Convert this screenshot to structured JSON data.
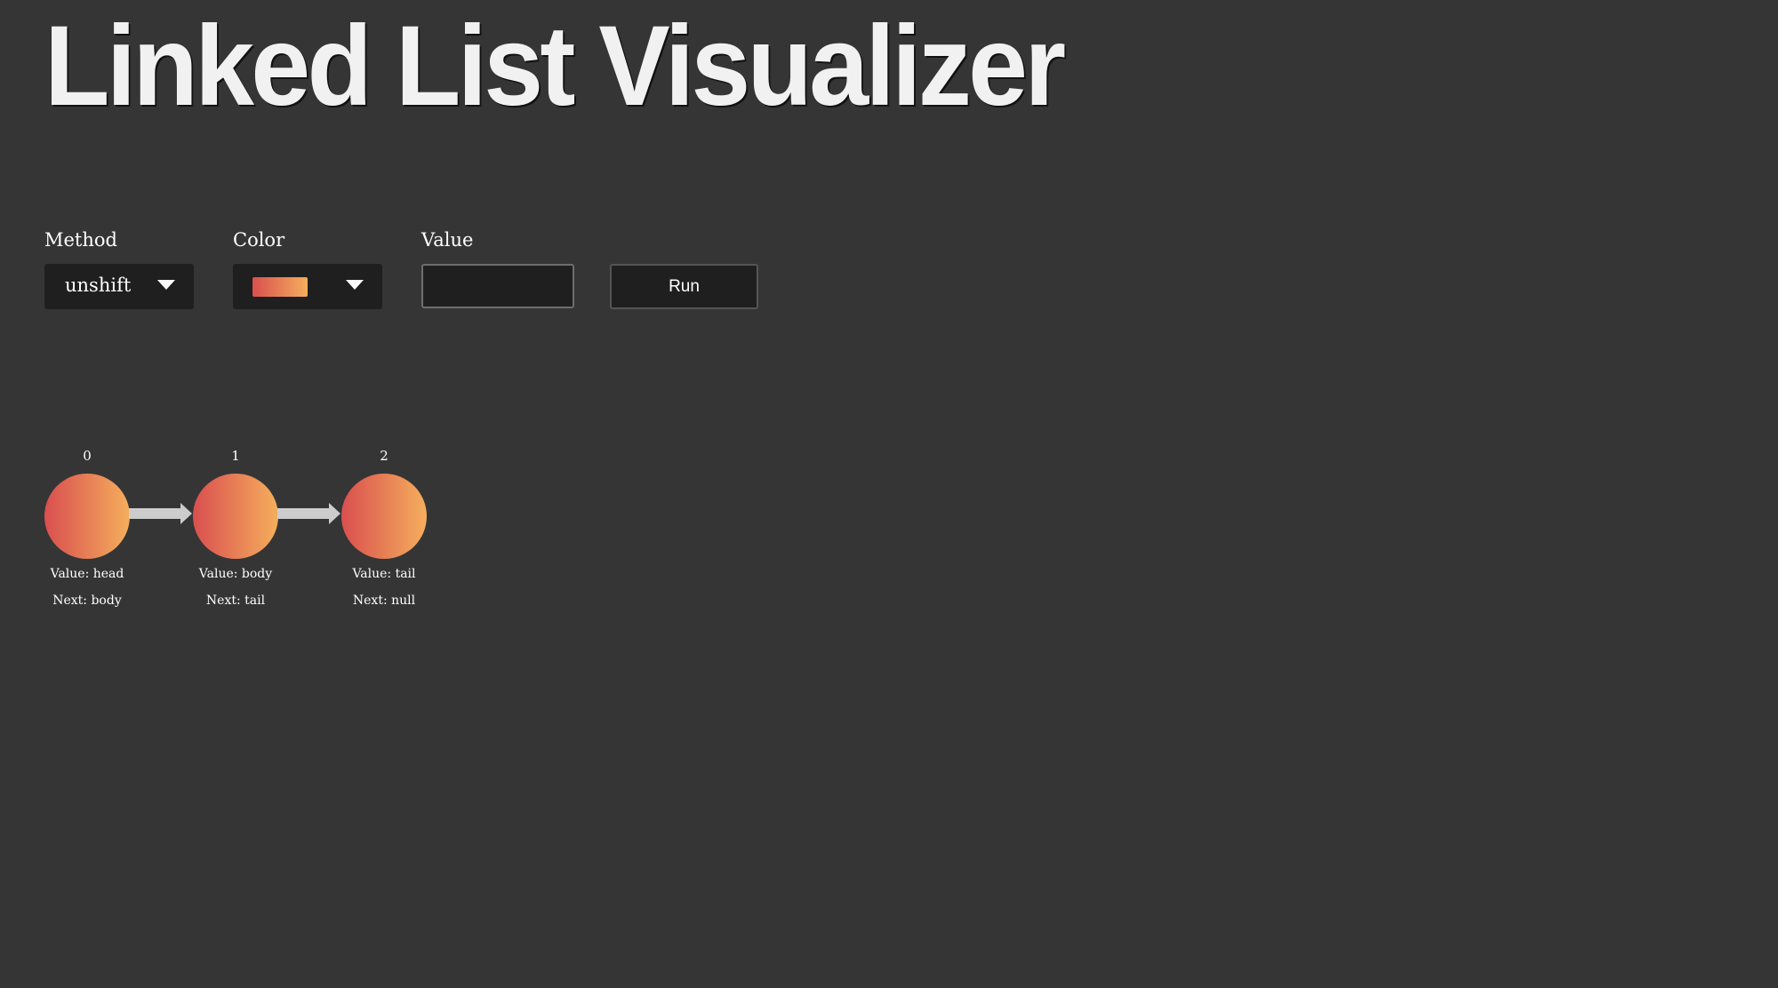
{
  "app": {
    "title": "Linked List Visualizer"
  },
  "controls": {
    "method": {
      "label": "Method",
      "selected": "unshift"
    },
    "color": {
      "label": "Color",
      "gradient_start": "#d94f4f",
      "gradient_end": "#f5ae5c"
    },
    "value": {
      "label": "Value",
      "current": "",
      "placeholder": ""
    },
    "run_button": {
      "label": "Run"
    }
  },
  "list": {
    "nodes": [
      {
        "index": "0",
        "value_text": "Value: head",
        "next_text": "Next: body"
      },
      {
        "index": "1",
        "value_text": "Value: body",
        "next_text": "Next: tail"
      },
      {
        "index": "2",
        "value_text": "Value: tail",
        "next_text": "Next: null"
      }
    ]
  },
  "colors": {
    "background": "#353535",
    "control_background": "#1f1f1f",
    "arrow": "#cccccc",
    "node_gradient_start": "#d94f4f",
    "node_gradient_end": "#f5ae5c"
  },
  "icons": {
    "dropdown": "chevron-down-icon",
    "link": "arrow-right-icon"
  }
}
